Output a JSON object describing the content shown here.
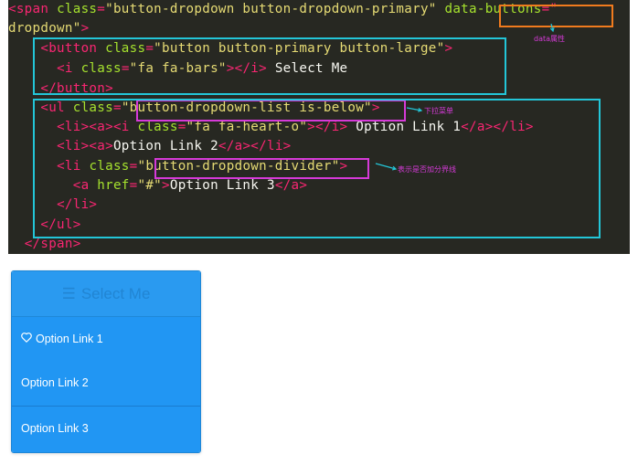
{
  "code_panel": {
    "lines": [
      [
        [
          "t",
          "<span "
        ],
        [
          "a",
          "class"
        ],
        [
          "t",
          "="
        ],
        [
          "s",
          "\"button-dropdown button-dropdown-primary\""
        ],
        [
          "p",
          " "
        ],
        [
          "a",
          "data-buttons"
        ],
        [
          "t",
          "=\""
        ]
      ],
      [
        [
          "s",
          "dropdown\""
        ],
        [
          "t",
          ">"
        ]
      ],
      [
        [
          "p",
          "    "
        ],
        [
          "t",
          "<button "
        ],
        [
          "a",
          "class"
        ],
        [
          "t",
          "="
        ],
        [
          "s",
          "\"button button-primary button-large\""
        ],
        [
          "t",
          ">"
        ]
      ],
      [
        [
          "p",
          "      "
        ],
        [
          "t",
          "<i "
        ],
        [
          "a",
          "class"
        ],
        [
          "t",
          "="
        ],
        [
          "s",
          "\"fa fa-bars\""
        ],
        [
          "t",
          "></i>"
        ],
        [
          "p",
          " Select Me"
        ]
      ],
      [
        [
          "p",
          "    "
        ],
        [
          "t",
          "</button>"
        ]
      ],
      [
        [
          "p",
          "    "
        ],
        [
          "t",
          "<ul "
        ],
        [
          "a",
          "class"
        ],
        [
          "t",
          "="
        ],
        [
          "s",
          "\"button-dropdown-list is-below\""
        ],
        [
          "t",
          ">"
        ]
      ],
      [
        [
          "p",
          "      "
        ],
        [
          "t",
          "<li><a><i "
        ],
        [
          "a",
          "class"
        ],
        [
          "t",
          "="
        ],
        [
          "s",
          "\"fa fa-heart-o\""
        ],
        [
          "t",
          "></i>"
        ],
        [
          "p",
          " Option Link 1"
        ],
        [
          "t",
          "</a></li>"
        ]
      ],
      [
        [
          "p",
          "      "
        ],
        [
          "t",
          "<li><a>"
        ],
        [
          "p",
          "Option Link 2"
        ],
        [
          "t",
          "</a></li>"
        ]
      ],
      [
        [
          "p",
          "      "
        ],
        [
          "t",
          "<li "
        ],
        [
          "a",
          "class"
        ],
        [
          "t",
          "="
        ],
        [
          "s",
          "\"button-dropdown-divider\""
        ],
        [
          "t",
          ">"
        ]
      ],
      [
        [
          "p",
          "        "
        ],
        [
          "t",
          "<a "
        ],
        [
          "a",
          "href"
        ],
        [
          "t",
          "="
        ],
        [
          "s",
          "\"#\""
        ],
        [
          "t",
          ">"
        ],
        [
          "p",
          "Option Link 3"
        ],
        [
          "t",
          "</a>"
        ]
      ],
      [
        [
          "p",
          "      "
        ],
        [
          "t",
          "</li>"
        ]
      ],
      [
        [
          "p",
          "    "
        ],
        [
          "t",
          "</ul>"
        ]
      ],
      [
        [
          "p",
          "  "
        ],
        [
          "t",
          "</span>"
        ]
      ]
    ],
    "annotations": {
      "data_attr": "data属性",
      "dropdown_menu": "下拉菜单",
      "divider_hint": "表示是否加分界线"
    }
  },
  "dropdown": {
    "button_icon": "☰",
    "button_label": "Select Me",
    "items": [
      {
        "icon": "heart-o-icon",
        "label": "Option Link 1"
      },
      {
        "label": "Option Link 2"
      },
      {
        "label": "Option Link 3"
      }
    ]
  },
  "colors": {
    "code_bg": "#272822",
    "button_bg": "#2a9af0",
    "list_bg": "#2196f3",
    "annotation": "#d63ad8",
    "highlight_orange": "#f07b1e",
    "highlight_cyan": "#23c6d8"
  }
}
